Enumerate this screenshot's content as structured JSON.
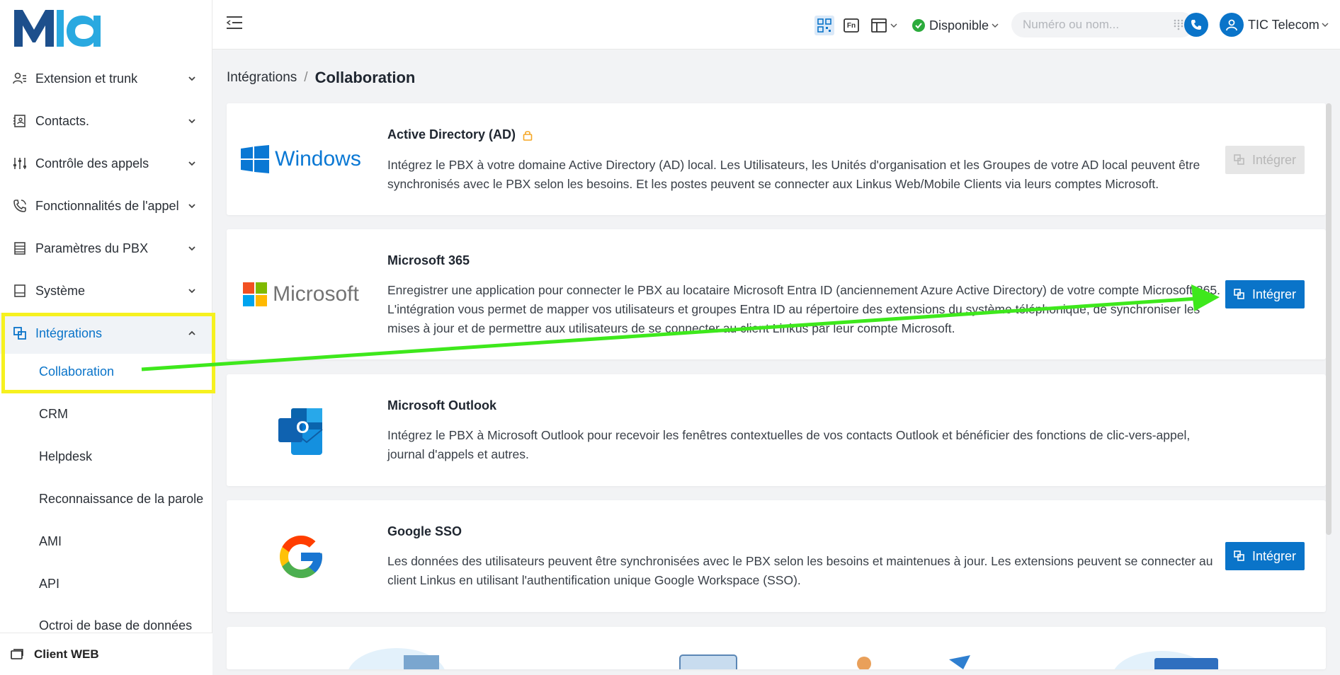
{
  "sidebar": {
    "items": [
      {
        "label": "Extension et trunk"
      },
      {
        "label": "Contacts."
      },
      {
        "label": "Contrôle des appels"
      },
      {
        "label": "Fonctionnalités de l'appel"
      },
      {
        "label": "Paramètres du PBX"
      },
      {
        "label": "Système"
      },
      {
        "label": "Intégrations"
      }
    ],
    "subitems": [
      {
        "label": "Collaboration"
      },
      {
        "label": "CRM"
      },
      {
        "label": "Helpdesk"
      },
      {
        "label": "Reconnaissance de la parole"
      },
      {
        "label": "AMI"
      },
      {
        "label": "API"
      },
      {
        "label": "Octroi de base de données"
      }
    ],
    "client_web": "Client WEB"
  },
  "header": {
    "status": "Disponible",
    "search_placeholder": "Numéro ou nom...",
    "user": "TIC Telecom",
    "lang_icon_text": "Fn"
  },
  "breadcrumb": {
    "parent": "Intégrations",
    "separator": "/",
    "current": "Collaboration"
  },
  "cards": [
    {
      "logo_text": "Windows",
      "title": "Active Directory (AD)",
      "description": "Intégrez le PBX à votre domaine Active Directory (AD) local. Les Utilisateurs, les Unités d'organisation et les Groupes de votre AD local peuvent être synchronisés avec le PBX selon les besoins. Et les postes peuvent se connecter aux Linkus Web/Mobile Clients via leurs comptes Microsoft.",
      "button": "Intégrer",
      "enabled": false
    },
    {
      "logo_text": "Microsoft",
      "title": "Microsoft 365",
      "description": "Enregistrer une application pour connecter le PBX au locataire Microsoft Entra ID (anciennement Azure Active Directory) de votre compte Microsoft 365. L'intégration vous permet de mapper vos utilisateurs et groupes Entra ID au répertoire des extensions du système téléphonique, de synchroniser les mises à jour et de permettre aux utilisateurs de se connecter au client Linkus par leur compte Microsoft.",
      "button": "Intégrer",
      "enabled": true
    },
    {
      "logo_text": "O",
      "title": "Microsoft Outlook",
      "description": "Intégrez le PBX à Microsoft Outlook pour recevoir les fenêtres contextuelles de vos contacts Outlook et bénéficier des fonctions de clic-vers-appel, journal d'appels et autres."
    },
    {
      "title": "Google SSO",
      "description": "Les données des utilisateurs peuvent être synchronisées avec le PBX selon les besoins et maintenues à jour. Les extensions peuvent se connecter au client Linkus en utilisant l'authentification unique Google Workspace (SSO).",
      "button": "Intégrer",
      "enabled": true
    }
  ],
  "colors": {
    "accent": "#0a74c9",
    "highlight": "#f6f11f",
    "arrow": "#3ee81c",
    "status_ok": "#2bab3c"
  }
}
